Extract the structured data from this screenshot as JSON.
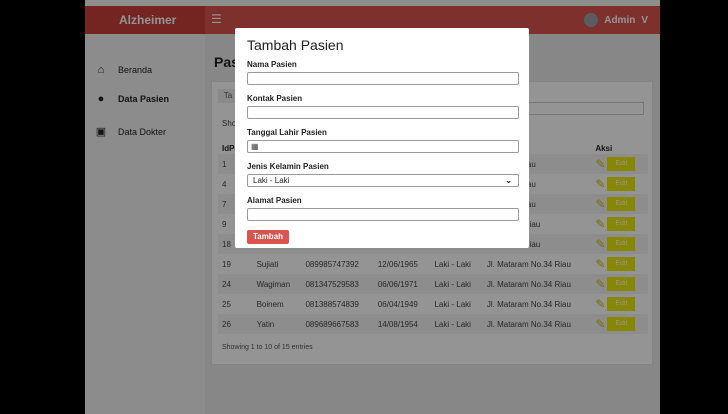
{
  "app": {
    "brand": "Alzheimer",
    "menu_icon": "hamburger-icon",
    "admin": "Admin",
    "admin_chevron": "V"
  },
  "sidebar": {
    "items": [
      {
        "label": "Beranda",
        "icon": "home-icon",
        "glyph": "⌂"
      },
      {
        "label": "Data Pasien",
        "icon": "user-icon",
        "glyph": "●"
      },
      {
        "label": "Data Dokter",
        "icon": "doctor-icon",
        "glyph": "▣"
      }
    ]
  },
  "page": {
    "title": "Pasi",
    "tab_stub": "Ta",
    "show_stub": "Sho"
  },
  "table": {
    "columns": [
      "IdPas",
      "",
      "",
      "",
      "",
      "at Pasien",
      "Aksi"
    ],
    "edit_label": "Edit",
    "rows": [
      {
        "id": "1",
        "name": "",
        "contact": "",
        "dob": "",
        "gender": "",
        "address": "m No.34 Riau"
      },
      {
        "id": "4",
        "name": "",
        "contact": "",
        "dob": "",
        "gender": "",
        "address": "m No.34 Riau"
      },
      {
        "id": "7",
        "name": "",
        "contact": "",
        "dob": "",
        "gender": "",
        "address": "m No.34 Riau"
      },
      {
        "id": "9",
        "name": "",
        "contact": "",
        "dob": "",
        "gender": "",
        "address": "am No.34 Riau"
      },
      {
        "id": "18",
        "name": "",
        "contact": "",
        "dob": "",
        "gender": "",
        "address": "am No.34 Riau"
      },
      {
        "id": "19",
        "name": "Sujiati",
        "contact": "089985747392",
        "dob": "12/06/1965",
        "gender": "Laki - Laki",
        "address": "Jl. Mataram No.34 Riau"
      },
      {
        "id": "24",
        "name": "Wagiman",
        "contact": "081347529583",
        "dob": "06/06/1971",
        "gender": "Laki - Laki",
        "address": "Jl. Mataram No.34 Riau"
      },
      {
        "id": "25",
        "name": "Boinem",
        "contact": "081388574839",
        "dob": "06/04/1949",
        "gender": "Laki - Laki",
        "address": "Jl. Mataram No.34 Riau"
      },
      {
        "id": "26",
        "name": "Yatin",
        "contact": "089689667583",
        "dob": "14/08/1954",
        "gender": "Laki - Laki",
        "address": "Jl. Mataram No.34 Riau"
      }
    ],
    "footer": "Showing 1 to 10 of 15 entries"
  },
  "modal": {
    "title": "Tambah Pasien",
    "nama_label": "Nama Pasien",
    "nama_value": "",
    "kontak_label": "Kontak Pasien",
    "kontak_value": "",
    "tgl_label": "Tanggal Lahir Pasien",
    "tgl_icon": "calendar-icon",
    "gender_label": "Jenis Kelamin Pasien",
    "gender_value": "Laki - Laki",
    "alamat_label": "Alamat Pasien",
    "alamat_value": "",
    "submit": "Tambah"
  },
  "colors": {
    "accent": "#d9534f",
    "edit": "#e8e800"
  }
}
